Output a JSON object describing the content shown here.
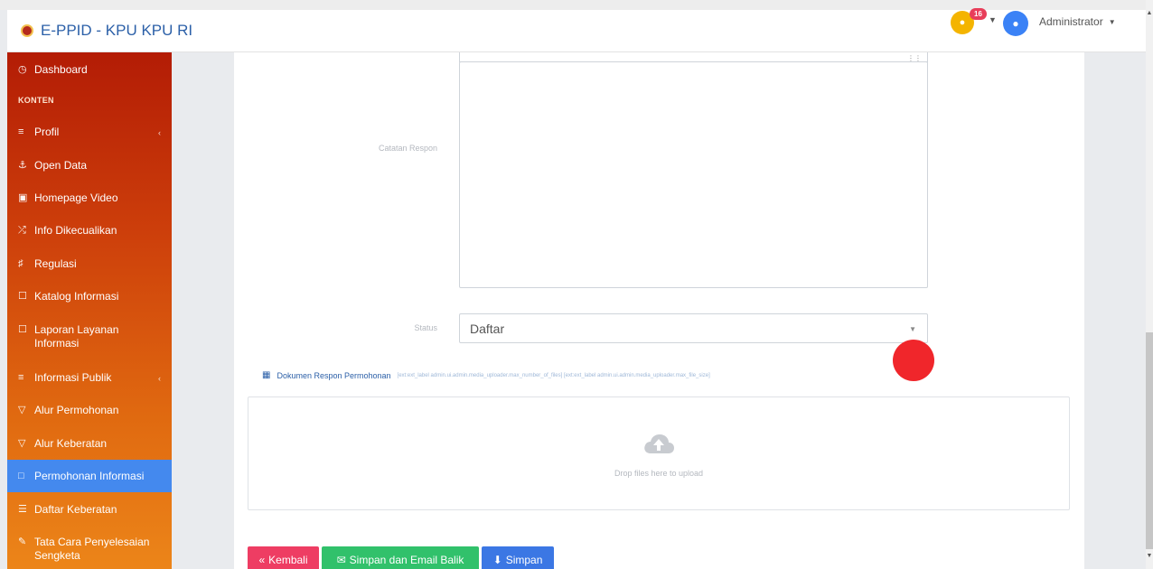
{
  "app": {
    "brand": "E-PPID - KPU KPU RI"
  },
  "header": {
    "notification_count": "16",
    "user_name": "Administrator"
  },
  "sidebar": {
    "section_header": "KONTEN",
    "items": [
      {
        "label": "Dashboard",
        "icon": "dashboard-icon"
      },
      {
        "label": "Profil",
        "icon": "list-icon",
        "has_caret": true
      },
      {
        "label": "Open Data",
        "icon": "anchor-icon"
      },
      {
        "label": "Homepage Video",
        "icon": "video-icon"
      },
      {
        "label": "Info Dikecualikan",
        "icon": "shuffle-icon"
      },
      {
        "label": "Regulasi",
        "icon": "tag-icon"
      },
      {
        "label": "Katalog Informasi",
        "icon": "file-icon"
      },
      {
        "label": "Laporan Layanan Informasi",
        "icon": "file-icon"
      },
      {
        "label": "Informasi Publik",
        "icon": "list-icon",
        "has_caret": true
      },
      {
        "label": "Alur Permohonan",
        "icon": "filter-icon"
      },
      {
        "label": "Alur Keberatan",
        "icon": "filter-icon"
      },
      {
        "label": "Permohonan Informasi",
        "icon": "folder-icon",
        "active": true
      },
      {
        "label": "Daftar Keberatan",
        "icon": "stack-icon"
      },
      {
        "label": "Tata Cara Penyelesaian Sengketa",
        "icon": "pen-icon"
      }
    ]
  },
  "form": {
    "catatan_label": "Catatan Respon",
    "catatan_value": "",
    "status_label": "Status",
    "status_value": "Daftar",
    "doc_title": "Dokumen Respon Permohonan",
    "doc_hint": "[ext:ext_label admin.ui.admin.media_uploader.max_number_of_files] [ext:ext_label admin.ui.admin.media_uploader.max_file_size]",
    "dropzone_text": "Drop files here to upload"
  },
  "buttons": {
    "back": "Kembali",
    "save_email": "Simpan dan Email Balik",
    "save": "Simpan"
  },
  "colors": {
    "sidebar_active": "#4489ee",
    "brand": "#2c60a8",
    "back_button": "#ee3d63",
    "email_button": "#31c16b",
    "save_button": "#3b77e4",
    "marker": "#f0262b"
  }
}
